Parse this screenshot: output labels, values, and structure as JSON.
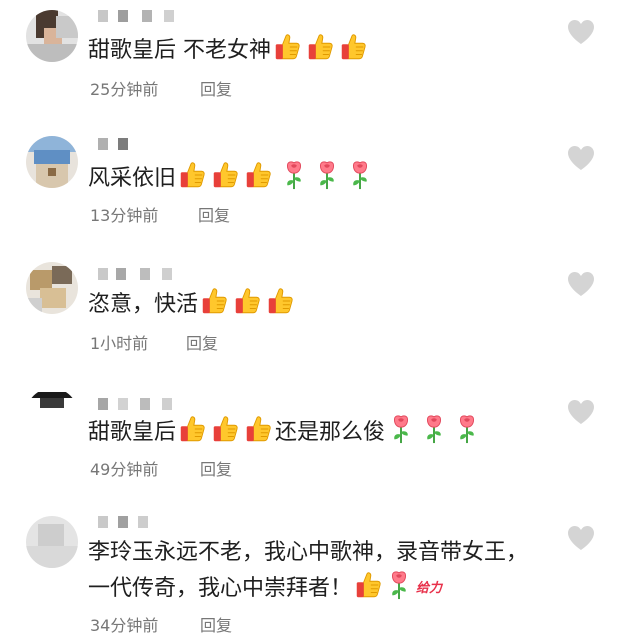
{
  "comments": [
    {
      "text": "甜歌皇后 不老女神",
      "emojis_after": [
        "thumbs-up",
        "thumbs-up",
        "thumbs-up"
      ],
      "time": "25分钟前",
      "reply_label": "回复"
    },
    {
      "text": "风采依旧",
      "emojis_after": [
        "thumbs-up",
        "thumbs-up",
        "thumbs-up",
        "rose",
        "rose",
        "rose"
      ],
      "time": "13分钟前",
      "reply_label": "回复"
    },
    {
      "text": "恣意，快活",
      "emojis_after": [
        "thumbs-up",
        "thumbs-up",
        "thumbs-up"
      ],
      "time": "1小时前",
      "reply_label": "回复"
    },
    {
      "text": "甜歌皇后",
      "emojis_mid": [
        "thumbs-up",
        "thumbs-up",
        "thumbs-up"
      ],
      "text2": "还是那么俊",
      "emojis_after": [
        "rose",
        "rose",
        "rose"
      ],
      "time": "49分钟前",
      "reply_label": "回复"
    },
    {
      "line1": "李玲玉永远不老，我心中歌神，录音带女王，",
      "line2": "一代传奇，我心中崇拜者！",
      "emojis_after": [
        "thumbs-up",
        "rose"
      ],
      "sticker_text": "给力",
      "time": "34分钟前",
      "reply_label": "回复"
    }
  ],
  "colors": {
    "text": "#1f1f1f",
    "meta": "#777777",
    "like_icon": "#d4d4d4",
    "sticker": "#e8304a"
  }
}
